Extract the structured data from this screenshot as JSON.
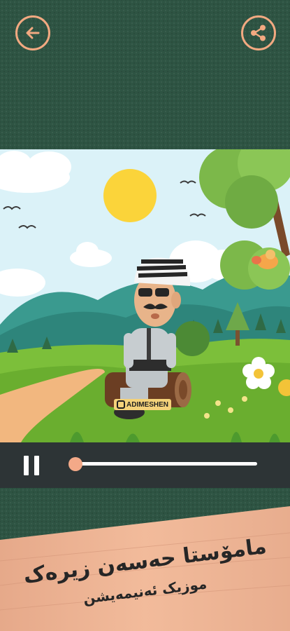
{
  "header": {
    "back_icon": "back-arrow-icon",
    "share_icon": "share-icon",
    "accent_color": "#f2a981"
  },
  "video": {
    "watermark": "ADIMESHEN",
    "watermark_icon": "instagram-icon"
  },
  "player": {
    "state": "playing",
    "pause_icon": "pause-icon",
    "progress": 0.0
  },
  "banner": {
    "title": "مامۆستا حەسەن زیرەک",
    "subtitle": "موزیک ئەنیمەیشن"
  }
}
